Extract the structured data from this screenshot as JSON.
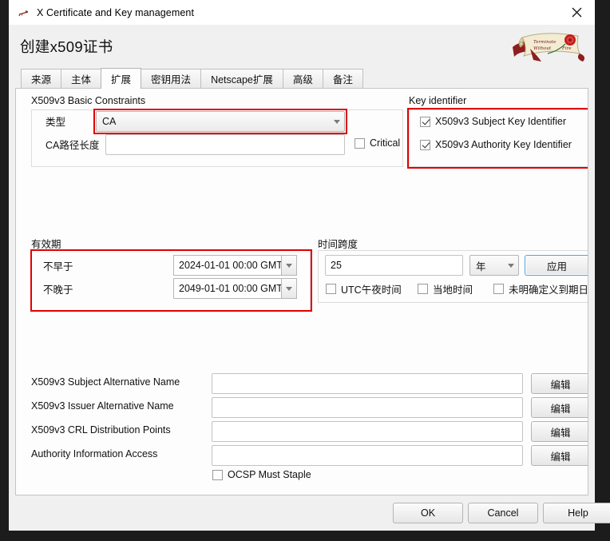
{
  "window": {
    "title": "X Certificate and Key management",
    "icon": "xca-key-icon",
    "close_label": "✕"
  },
  "header": {
    "title_prefix": "创建",
    "title_mid": "x509",
    "title_suffix": "证书",
    "title_full": "创建x509证书",
    "logo_name": "xca-scroll-rose-logo"
  },
  "tabs": [
    {
      "label": "来源",
      "active": false
    },
    {
      "label": "主体",
      "active": false
    },
    {
      "label": "扩展",
      "active": true
    },
    {
      "label": "密钥用法",
      "active": false
    },
    {
      "label": "Netscape扩展",
      "active": false
    },
    {
      "label": "高级",
      "active": false
    },
    {
      "label": "备注",
      "active": false
    }
  ],
  "basic_constraints": {
    "group_label": "X509v3 Basic Constraints",
    "type_label": "类型",
    "type_value": "CA",
    "pathlen_label": "CA路径长度",
    "pathlen_value": "",
    "critical_label": "Critical",
    "critical_checked": false
  },
  "key_identifier": {
    "group_label": "Key identifier",
    "subject_label": "X509v3 Subject Key Identifier",
    "subject_checked": true,
    "authority_label": "X509v3 Authority Key Identifier",
    "authority_checked": true
  },
  "validity": {
    "group_label": "有效期",
    "not_before_label": "不早于",
    "not_before_value": "2024-01-01 00:00 GMT",
    "not_after_label": "不晚于",
    "not_after_value": "2049-01-01 00:00 GMT"
  },
  "timespan": {
    "group_label": "时间跨度",
    "amount_value": "25",
    "unit_value": "年",
    "apply_label": "应用",
    "utc_midnight_label": "UTC午夜时间",
    "utc_midnight_checked": false,
    "local_time_label": "当地时间",
    "local_time_checked": false,
    "no_wellbeing_label": "未明确定义到期日",
    "no_wellbeing_checked": false
  },
  "extensions": {
    "rows": [
      {
        "label": "X509v3 Subject Alternative Name",
        "value": "",
        "button": "编辑"
      },
      {
        "label": "X509v3 Issuer Alternative Name",
        "value": "",
        "button": "编辑"
      },
      {
        "label": "X509v3 CRL Distribution Points",
        "value": "",
        "button": "编辑"
      },
      {
        "label": "Authority Information Access",
        "value": "",
        "button": "编辑"
      }
    ],
    "ocsp_label": "OCSP Must Staple",
    "ocsp_checked": false
  },
  "footer": {
    "ok_label": "OK",
    "cancel_label": "Cancel",
    "help_label": "Help"
  },
  "colors": {
    "highlight": "#e00000",
    "focus": "#4fa3e3",
    "window_bg": "#f0f0f0",
    "panel_bg": "#fdfdfd"
  }
}
